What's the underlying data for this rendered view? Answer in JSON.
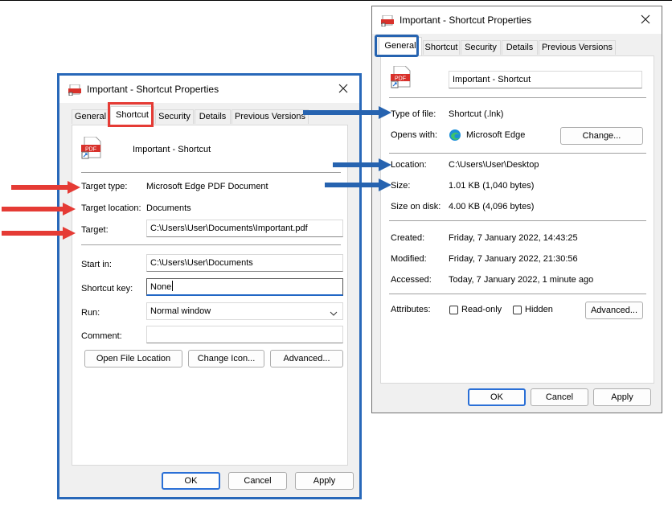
{
  "left_dialog": {
    "title": "Important - Shortcut Properties",
    "tabs": [
      "General",
      "Shortcut",
      "Security",
      "Details",
      "Previous Versions"
    ],
    "active_tab": "Shortcut",
    "file_name": "Important - Shortcut",
    "pdf_icon_text": "PDF",
    "fields": {
      "target_type_label": "Target type:",
      "target_type_value": "Microsoft Edge PDF Document",
      "target_location_label": "Target location:",
      "target_location_value": "Documents",
      "target_label": "Target:",
      "target_value": "C:\\Users\\User\\Documents\\Important.pdf",
      "start_in_label": "Start in:",
      "start_in_value": "C:\\Users\\User\\Documents",
      "shortcut_key_label": "Shortcut key:",
      "shortcut_key_value": "None",
      "run_label": "Run:",
      "run_value": "Normal window",
      "comment_label": "Comment:",
      "comment_value": ""
    },
    "buttons": {
      "open_file_location": "Open File Location",
      "change_icon": "Change Icon...",
      "advanced": "Advanced...",
      "ok": "OK",
      "cancel": "Cancel",
      "apply": "Apply"
    }
  },
  "right_dialog": {
    "title": "Important - Shortcut Properties",
    "tabs": [
      "General",
      "Shortcut",
      "Security",
      "Details",
      "Previous Versions"
    ],
    "active_tab": "General",
    "pdf_icon_text": "PDF",
    "file_name_value": "Important - Shortcut",
    "fields": {
      "type_label": "Type of file:",
      "type_value": "Shortcut (.lnk)",
      "opens_with_label": "Opens with:",
      "opens_with_value": "Microsoft Edge",
      "location_label": "Location:",
      "location_value": "C:\\Users\\User\\Desktop",
      "size_label": "Size:",
      "size_value": "1.01 KB (1,040 bytes)",
      "size_on_disk_label": "Size on disk:",
      "size_on_disk_value": "4.00 KB (4,096 bytes)",
      "created_label": "Created:",
      "created_value": "Friday, 7 January 2022, 14:43:25",
      "modified_label": "Modified:",
      "modified_value": "Friday, 7 January 2022, 21:30:56",
      "accessed_label": "Accessed:",
      "accessed_value": "Today, 7 January 2022, 1 minute ago",
      "attributes_label": "Attributes:",
      "readonly_label": "Read-only",
      "hidden_label": "Hidden"
    },
    "buttons": {
      "change": "Change...",
      "advanced": "Advanced...",
      "ok": "OK",
      "cancel": "Cancel",
      "apply": "Apply"
    }
  },
  "colors": {
    "red_arrow": "#e53b35",
    "blue_arrow": "#2663b0",
    "dialog_bg": "#f0f0f0",
    "accent": "#2a6fd6"
  }
}
